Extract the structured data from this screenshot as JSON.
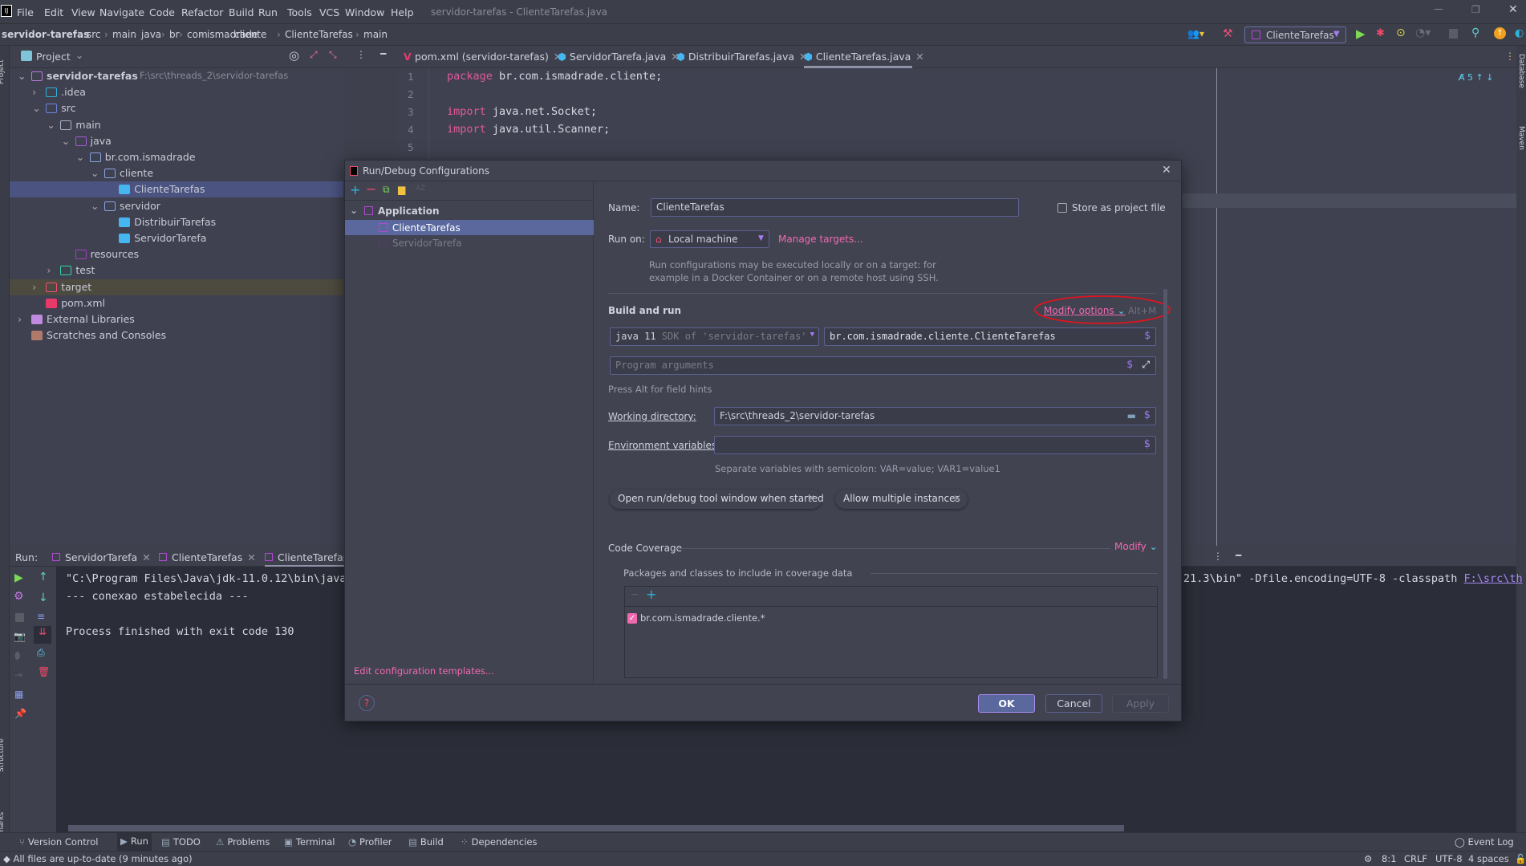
{
  "window": {
    "title": "servidor-tarefas - ClienteTarefas.java"
  },
  "menu": [
    "File",
    "Edit",
    "View",
    "Navigate",
    "Code",
    "Refactor",
    "Build",
    "Run",
    "Tools",
    "VCS",
    "Window",
    "Help"
  ],
  "breadcrumb": [
    "servidor-tarefas",
    "src",
    "main",
    "java",
    "br",
    "com",
    "ismadrade",
    "cliente",
    "ClienteTarefas",
    "main"
  ],
  "toolbar": {
    "run_config": "ClienteTarefas"
  },
  "project_panel": {
    "title": "Project",
    "tree": [
      {
        "label": "servidor-tarefas",
        "extra": "F:\\src\\threads_2\\servidor-tarefas",
        "level": 0,
        "arrow": "down",
        "icon": "module-folder-icon",
        "color": "#b87ad9"
      },
      {
        "label": ".idea",
        "level": 1,
        "arrow": "right",
        "icon": "idea-folder-icon",
        "color": "#2fb3d9"
      },
      {
        "label": "src",
        "level": 1,
        "arrow": "down",
        "icon": "source-folder-icon",
        "color": "#6b84d9"
      },
      {
        "label": "main",
        "level": 2,
        "arrow": "down",
        "icon": "folder-icon",
        "color": "#aab0c6"
      },
      {
        "label": "java",
        "level": 3,
        "arrow": "down",
        "icon": "source-root-icon",
        "color": "#a35ad6"
      },
      {
        "label": "br.com.ismadrade",
        "level": 4,
        "arrow": "down",
        "icon": "package-icon",
        "color": "#8aa4e0"
      },
      {
        "label": "cliente",
        "level": 5,
        "arrow": "down",
        "icon": "package-icon",
        "color": "#8aa4e0"
      },
      {
        "label": "ClienteTarefas",
        "level": 6,
        "arrow": "",
        "icon": "java-class-icon",
        "color": "#45b6f0",
        "selected": true
      },
      {
        "label": "servidor",
        "level": 5,
        "arrow": "down",
        "icon": "package-icon",
        "color": "#8aa4e0"
      },
      {
        "label": "DistribuirTarefas",
        "level": 6,
        "arrow": "",
        "icon": "java-class-icon",
        "color": "#45b6f0"
      },
      {
        "label": "ServidorTarefa",
        "level": 6,
        "arrow": "",
        "icon": "java-class-icon",
        "color": "#45b6f0"
      },
      {
        "label": "resources",
        "level": 3,
        "arrow": "",
        "icon": "resources-folder-icon",
        "color": "#a040c0"
      },
      {
        "label": "test",
        "level": 2,
        "arrow": "right",
        "icon": "test-folder-icon",
        "color": "#2ed6a0"
      },
      {
        "label": "target",
        "level": 1,
        "arrow": "right",
        "icon": "excluded-folder-icon",
        "color": "#f0507a",
        "excluded": true
      },
      {
        "label": "pom.xml",
        "level": 1,
        "arrow": "",
        "icon": "maven-icon",
        "color": "#e83a6a"
      },
      {
        "label": "External Libraries",
        "level": 0,
        "arrow": "right",
        "icon": "library-icon",
        "color": "#c08ae0"
      },
      {
        "label": "Scratches and Consoles",
        "level": 0,
        "arrow": "",
        "icon": "scratches-icon",
        "color": "#b07a6a"
      }
    ]
  },
  "editor": {
    "tabs": [
      "pom.xml (servidor-tarefas)",
      "ServidorTarefa.java",
      "DistribuirTarefas.java",
      "ClienteTarefas.java"
    ],
    "active_tab": 3,
    "lines": [
      {
        "n": "1",
        "kw": "package",
        "rest": " br.com.ismadrade.cliente;"
      },
      {
        "n": "2",
        "kw": "",
        "rest": ""
      },
      {
        "n": "3",
        "kw": "import",
        "rest": " java.net.Socket;"
      },
      {
        "n": "4",
        "kw": "import",
        "rest": " java.util.Scanner;"
      },
      {
        "n": "5",
        "kw": "",
        "rest": ""
      }
    ],
    "inspection_count": "5"
  },
  "run_panel": {
    "label": "Run:",
    "tabs": [
      "ServidorTarefa",
      "ClienteTarefas",
      "ClienteTarefas"
    ],
    "console": [
      "\"C:\\Program Files\\Java\\jdk-11.0.12\\bin\\java",
      "--- conexao estabelecida ---",
      "",
      "Process finished with exit code 130"
    ],
    "console_tail": "21.3\\bin\" -Dfile.encoding=UTF-8 -classpath ",
    "console_link": "F:\\src\\th"
  },
  "bottom_tools": [
    "Version Control",
    "Run",
    "TODO",
    "Problems",
    "Terminal",
    "Profiler",
    "Build",
    "Dependencies"
  ],
  "event_log": "Event Log",
  "status": {
    "message": "All files are up-to-date (9 minutes ago)",
    "position": "8:1",
    "line_sep": "CRLF",
    "encoding": "UTF-8",
    "indent": "4 spaces"
  },
  "dialog": {
    "title": "Run/Debug Configurations",
    "tree_group": "Application",
    "tree_items": [
      "ClienteTarefas",
      "ServidorTarefa"
    ],
    "name_label": "Name:",
    "name_value": "ClienteTarefas",
    "store_label": "Store as project file",
    "store_checked": false,
    "run_on_label": "Run on:",
    "run_on_value": "Local machine",
    "manage_targets": "Manage targets...",
    "run_on_desc1": "Run configurations may be executed locally or on a target: for",
    "run_on_desc2": "example in a Docker Container or on a remote host using SSH.",
    "build_run_title": "Build and run",
    "modify_options": "Modify options",
    "modify_shortcut": "Alt+M",
    "jdk_value": "java 11",
    "jdk_hint": "SDK of 'servidor-tarefas'",
    "main_class": "br.com.ismadrade.cliente.ClienteTarefas",
    "program_args_placeholder": "Program arguments",
    "press_alt_hint": "Press Alt for field hints",
    "working_dir_label": "Working directory:",
    "working_dir_value": "F:\\src\\threads_2\\servidor-tarefas",
    "env_label": "Environment variables:",
    "env_value": "",
    "env_hint": "Separate variables with semicolon: VAR=value; VAR1=value1",
    "chips": [
      "Open run/debug tool window when started",
      "Allow multiple instances"
    ],
    "coverage_title": "Code Coverage",
    "coverage_modify": "Modify",
    "coverage_packages_label": "Packages and classes to include in coverage data",
    "coverage_items": [
      {
        "label": "br.com.ismadrade.cliente.*",
        "checked": true
      }
    ],
    "edit_templates": "Edit configuration templates...",
    "ok": "OK",
    "cancel": "Cancel",
    "apply": "Apply"
  },
  "colors": {
    "accent": "#f06ab0",
    "selection": "#4b5380",
    "annotation": "#e0141e"
  }
}
